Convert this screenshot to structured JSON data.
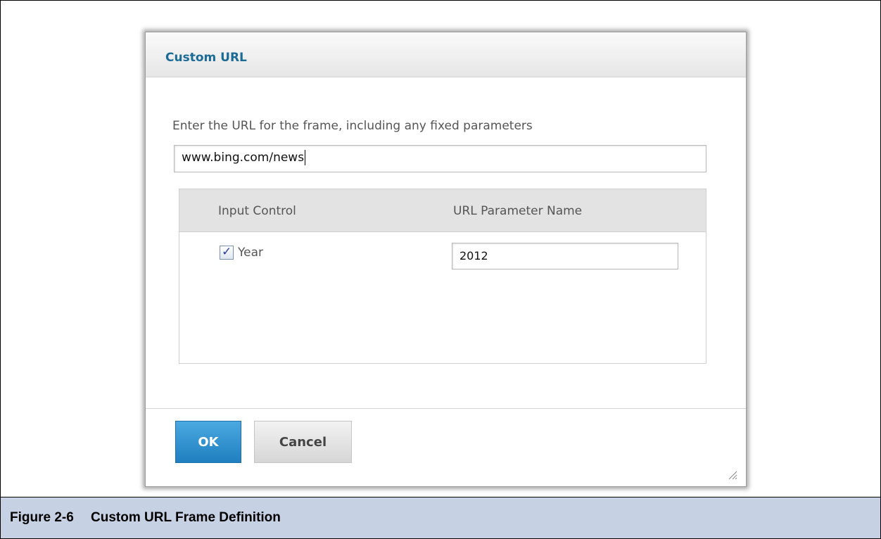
{
  "dialog": {
    "title": "Custom URL",
    "url_label": "Enter the URL for the frame, including any fixed parameters",
    "url_value": "www.bing.com/news",
    "table": {
      "columns": [
        "Input Control",
        "URL Parameter Name"
      ],
      "rows": [
        {
          "checked": true,
          "control": "Year",
          "parameter_name": "2012"
        }
      ]
    },
    "ok_label": "OK",
    "cancel_label": "Cancel"
  },
  "caption": {
    "number": "Figure 2-6",
    "text": "Custom URL Frame Definition"
  },
  "colors": {
    "title": "#1b6b97",
    "ok_button": "#2b8fd0",
    "caption_bar": "#c7d1e4"
  },
  "icons": {
    "checkbox": "checkmark-icon",
    "resize": "resize-grip-icon"
  }
}
